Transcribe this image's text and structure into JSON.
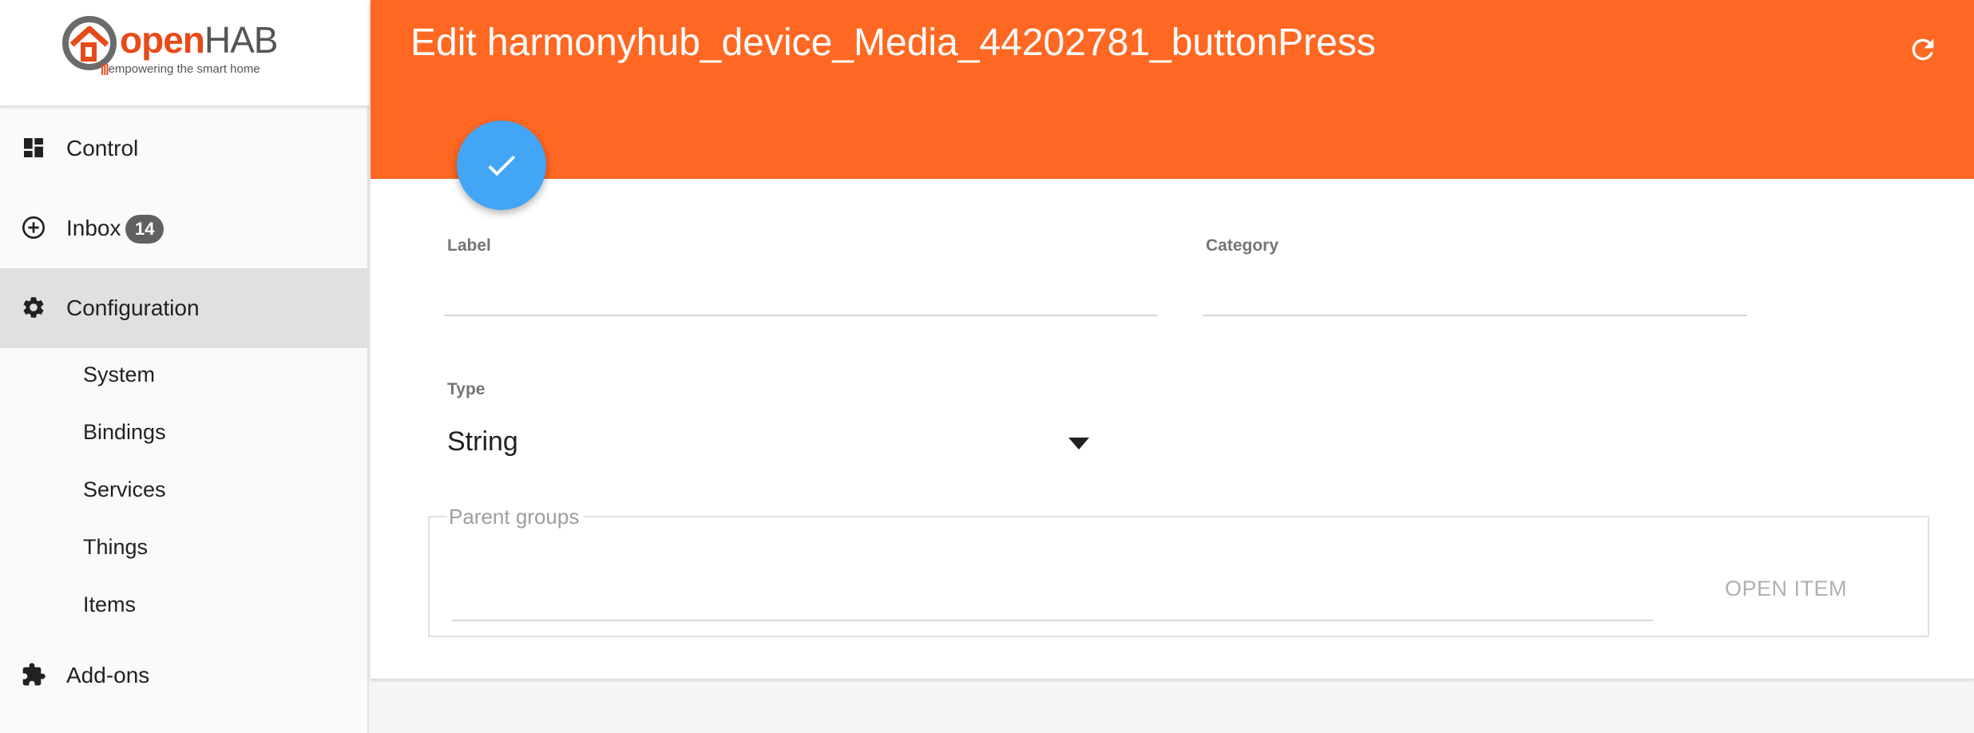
{
  "brand": {
    "logo_open": "open",
    "logo_hab": "HAB",
    "tagline_dashes": "|||",
    "tagline": "empowering the smart home"
  },
  "sidebar": {
    "items": [
      {
        "label": "Control",
        "icon": "dashboard-icon"
      },
      {
        "label": "Inbox",
        "icon": "add-circle-icon",
        "badge": "14"
      },
      {
        "label": "Configuration",
        "icon": "gear-icon",
        "active": true
      },
      {
        "label": "Add-ons",
        "icon": "puzzle-icon"
      }
    ],
    "sub_items": [
      "System",
      "Bindings",
      "Services",
      "Things",
      "Items"
    ]
  },
  "header": {
    "title": "Edit harmonyhub_device_Media_44202781_buttonPress"
  },
  "form": {
    "label_label": "Label",
    "label_value": "",
    "category_label": "Category",
    "category_value": "",
    "type_label": "Type",
    "type_value": "String",
    "parent_groups_label": "Parent groups",
    "open_item_label": "OPEN ITEM"
  },
  "colors": {
    "header_bg": "#ff6822",
    "fab_bg": "#42a5f5",
    "active_nav_bg": "#e0e0e0"
  }
}
